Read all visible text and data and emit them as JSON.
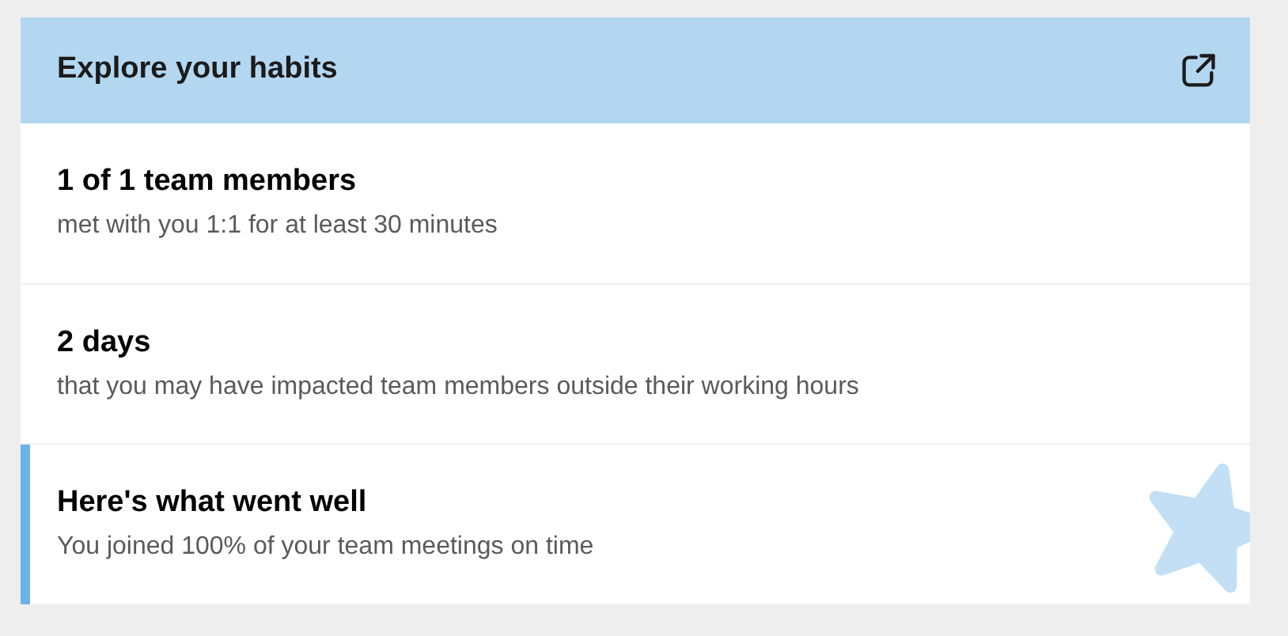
{
  "card": {
    "title": "Explore your habits",
    "items": [
      {
        "kind": "stat",
        "title": "1 of 1 team members",
        "subtitle": "met with you 1:1 for at least 30 minutes"
      },
      {
        "kind": "stat",
        "title": "2 days",
        "subtitle": "that you may have impacted team members outside their working hours"
      },
      {
        "kind": "highlight",
        "title": "Here's what went well",
        "subtitle": "You joined 100% of your team meetings on time"
      }
    ]
  }
}
